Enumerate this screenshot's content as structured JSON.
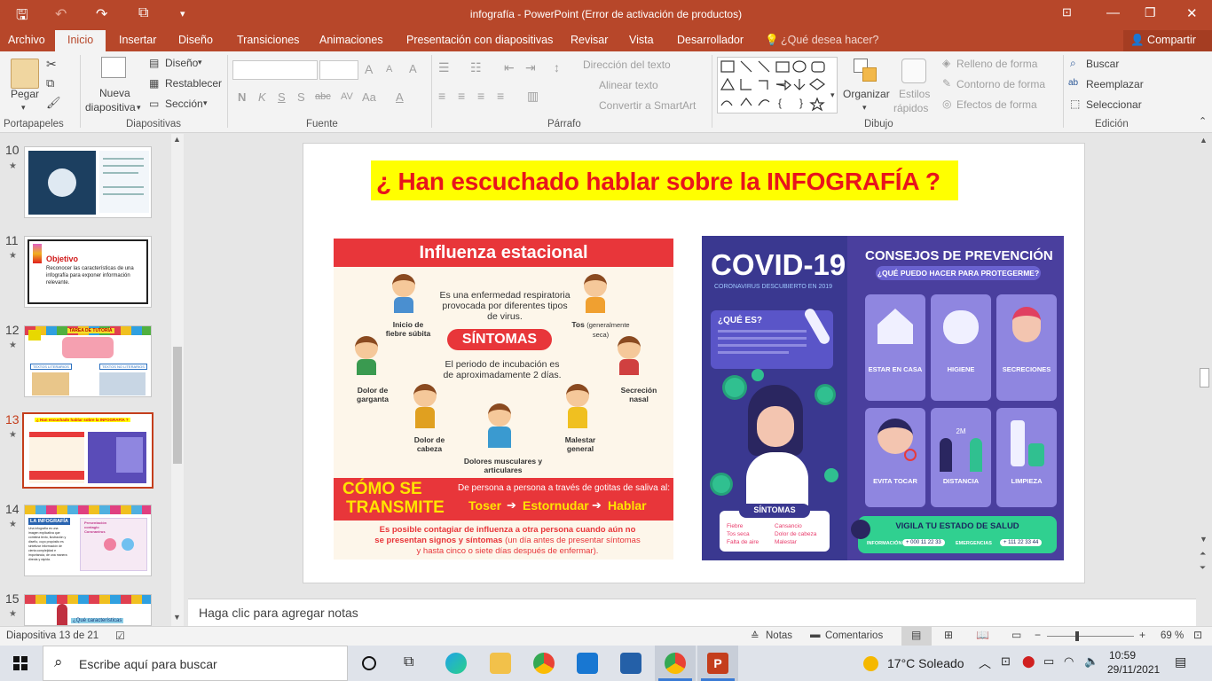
{
  "window": {
    "title": "infografía - PowerPoint (Error de activación de productos)"
  },
  "tabs": [
    "Archivo",
    "Inicio",
    "Insertar",
    "Diseño",
    "Transiciones",
    "Animaciones",
    "Presentación con diapositivas",
    "Revisar",
    "Vista",
    "Desarrollador"
  ],
  "tell_me": "¿Qué desea hacer?",
  "share": "Compartir",
  "ribbon": {
    "clipboard": {
      "paste": "Pegar",
      "group": "Portapapeles"
    },
    "slides": {
      "new_slide_1": "Nueva",
      "new_slide_2": "diapositiva",
      "layout": "Diseño",
      "reset": "Restablecer",
      "section": "Sección",
      "group": "Diapositivas"
    },
    "font": {
      "group": "Fuente",
      "bold": "N",
      "italic": "K",
      "underline": "S",
      "strike": "S",
      "shadow": "abc",
      "spacing": "AV",
      "case": "Aa"
    },
    "paragraph": {
      "text_direction": "Dirección del texto",
      "align_text": "Alinear texto",
      "smartart": "Convertir a SmartArt",
      "group": "Párrafo"
    },
    "drawing": {
      "arrange": "Organizar",
      "styles_1": "Estilos",
      "styles_2": "rápidos",
      "fill": "Relleno de forma",
      "outline": "Contorno de forma",
      "effects": "Efectos de forma",
      "group": "Dibujo"
    },
    "editing": {
      "find": "Buscar",
      "replace": "Reemplazar",
      "select": "Seleccionar",
      "group": "Edición"
    }
  },
  "slides_panel": [
    {
      "num": "10"
    },
    {
      "num": "11",
      "title": "Objetivo",
      "text": "Reconocer las características de una infografía para exponer información relevante."
    },
    {
      "num": "12",
      "caption": "TAREA DE TUTORÍA",
      "chip_a": "TEXTOS LITERARIOS",
      "chip_b": "TEXTOS NO LITERARIOS"
    },
    {
      "num": "13",
      "caption": "¿ Han escuchado hablar sobre la INFOGRAFÍA ?"
    },
    {
      "num": "14",
      "title": "LA INFOGRAFÍA",
      "text": "Una infografía es una imagen explicativa que combina texto, ilustración y diseño, cuyo propósito es sintetizar información de cierta complejidad e importancia, de una manera directa y rápida.",
      "side": "Presentación contagio Coronavirus"
    },
    {
      "num": "15",
      "caption": "¿Qué características"
    }
  ],
  "slide": {
    "heading": "¿ Han escuchado hablar sobre la INFOGRAFÍA ?",
    "flu": {
      "title": "Influenza estacional",
      "intro": "Es una enfermedad respiratoria provocada por diferentes tipos de virus.",
      "symptoms_label": "SÍNTOMAS",
      "incubation": "El periodo de incubación es de aproximadamente 2 días.",
      "s1": "Inicio de fiebre súbita",
      "s2": "Tos",
      "s2b": "(generalmente seca)",
      "s3": "Dolor de garganta",
      "s4": "Secreción nasal",
      "s5": "Dolor de cabeza",
      "s6": "Malestar general",
      "s7": "Dolores musculares y articulares",
      "transmit_1": "CÓMO SE",
      "transmit_2": "TRANSMITE",
      "transmit_text": "De persona a persona a través de gotitas de saliva al:",
      "t1": "Toser",
      "t2": "Estornudar",
      "t3": "Hablar",
      "footer_bold": "Es posible contagiar de influenza a otra persona cuando aún no se presentan signos y síntomas",
      "footer_rest": "(un día antes de presentar síntomas y hasta cinco o siete días después de enfermar)."
    },
    "covid": {
      "title": "COVID-19",
      "subtitle": "CORONAVIRUS DESCUBIERTO EN 2019",
      "what_is": "¿QUÉ ES?",
      "advice_title": "CONSEJOS DE PREVENCIÓN",
      "advice_sub": "¿QUÉ PUEDO HACER PARA PROTEGERME?",
      "tips": [
        "ESTAR EN CASA",
        "HIGIENE",
        "SECRECIONES",
        "EVITA TOCAR",
        "DISTANCIA",
        "LIMPIEZA"
      ],
      "distance": "2M",
      "symptoms_label": "SÍNTOMAS",
      "symptoms": [
        "Fiebre",
        "Cansancio",
        "Tos seca",
        "Dolor de cabeza",
        "Falta de aire",
        "Malestar"
      ],
      "monitor": "VIGILA TU ESTADO DE SALUD",
      "info_label": "INFORMACIÓN",
      "info_num": "+ 000 11 22 33",
      "emerg_label": "EMERGENCIAS",
      "emerg_num": "+ 111 22 33 44"
    }
  },
  "notes_placeholder": "Haga clic para agregar notas",
  "status": {
    "slide_counter": "Diapositiva 13 de 21",
    "notes": "Notas",
    "comments": "Comentarios",
    "zoom": "69 %"
  },
  "taskbar": {
    "search_placeholder": "Escribe aquí para buscar",
    "weather": "17°C  Soleado",
    "time": "10:59",
    "date": "29/11/2021"
  },
  "colors": {
    "accent": "#b7472a",
    "selected_thumb": "#c43e1c",
    "heading_bg": "#ffff00",
    "heading_text": "#e8141c"
  }
}
